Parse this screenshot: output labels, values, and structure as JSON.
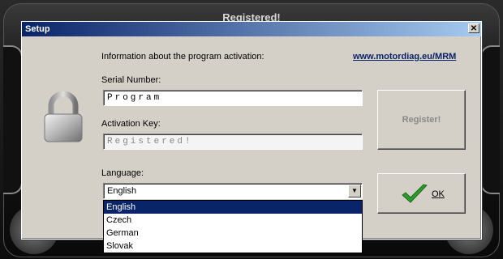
{
  "background": {
    "title": "Registered!"
  },
  "dialog": {
    "title": "Setup",
    "close_glyph": "✕",
    "info_text": "Information about the program activation:",
    "website_link": "www.motordiag.eu/MRM",
    "lock_icon": "padlock-icon",
    "serial": {
      "label": "Serial Number:",
      "value": "Program"
    },
    "activation": {
      "label": "Activation Key:",
      "value": "Registered!"
    },
    "register_button": "Register!",
    "language": {
      "label": "Language:",
      "selected": "English",
      "options": [
        "English",
        "Czech",
        "German",
        "Slovak"
      ]
    },
    "ok_button": "OK",
    "ok_icon": "checkmark-icon"
  },
  "colors": {
    "titlebar_start": "#0a246a",
    "titlebar_end": "#a6caf0",
    "dialog_bg": "#d4d0c8",
    "selection": "#0a246a",
    "check_green": "#2e9a2e"
  }
}
